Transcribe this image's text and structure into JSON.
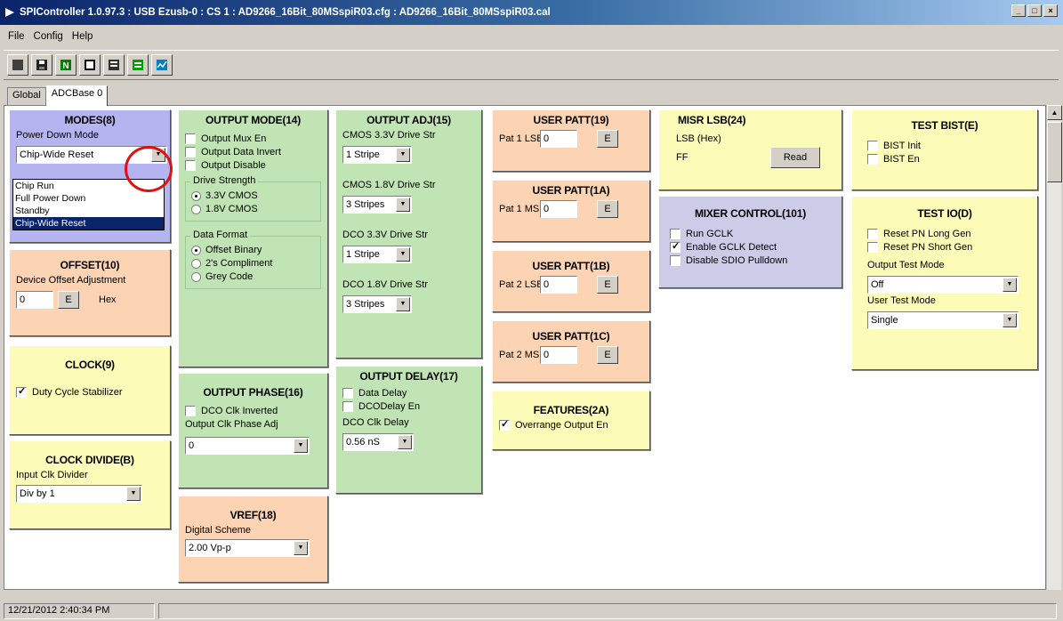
{
  "window": {
    "title": "SPIController 1.0.97.3 : USB Ezusb-0 : CS 1 : AD9266_16Bit_80MSspiR03.cfg : AD9266_16Bit_80MSspiR03.cal",
    "min": "_",
    "max": "□",
    "close": "×"
  },
  "menu": [
    "File",
    "Config",
    "Help"
  ],
  "toolbar": {
    "icons": [
      "stop-icon",
      "save-icon",
      "new-icon",
      "window-icon",
      "register-icon",
      "export-icon",
      "graph-icon"
    ],
    "colors": [
      "#404040",
      "#202020",
      "#008000",
      "#000000",
      "#303030",
      "#00a000",
      "#0080c0"
    ]
  },
  "tabs": [
    {
      "label": "Global"
    },
    {
      "label": "ADCBase 0"
    }
  ],
  "colors": {
    "modes": "#b4b4f0",
    "green": "#c0e4b4",
    "orange": "#fcd4b4",
    "yellow": "#fcfcb8",
    "lavender": "#cccce8",
    "highlight": "#e01010"
  },
  "modes": {
    "title": "MODES(8)",
    "label": "Power Down Mode",
    "value": "Chip-Wide Reset",
    "options": [
      "Chip Run",
      "Full Power Down",
      "Standby",
      "Chip-Wide Reset"
    ]
  },
  "offset": {
    "title": "OFFSET(10)",
    "label": "Device Offset Adjustment",
    "value": "0",
    "e": "E",
    "unit": "Hex"
  },
  "clock": {
    "title": "CLOCK(9)",
    "cb": "Duty Cycle Stabilizer",
    "checked": true
  },
  "clock_divide": {
    "title": "CLOCK DIVIDE(B)",
    "label": "Input Clk Divider",
    "value": "Div by 1"
  },
  "output_mode": {
    "title": "OUTPUT MODE(14)",
    "checkboxes": [
      "Output Mux En",
      "Output Data Invert",
      "Output Disable"
    ],
    "drive_strength": {
      "label": "Drive Strength",
      "options": [
        "3.3V CMOS",
        "1.8V CMOS"
      ],
      "selected": 0
    },
    "data_format": {
      "label": "Data Format",
      "options": [
        "Offset Binary",
        "2's Compliment",
        "Grey Code"
      ],
      "selected": 0
    }
  },
  "output_phase": {
    "title": "OUTPUT PHASE(16)",
    "cb": "DCO Clk Inverted",
    "label": "Output Clk Phase Adj",
    "value": "0"
  },
  "vref": {
    "title": "VREF(18)",
    "label": "Digital Scheme",
    "value": "2.00 Vp-p"
  },
  "output_adj": {
    "title": "OUTPUT ADJ(15)",
    "items": [
      {
        "label": "CMOS 3.3V Drive Str",
        "value": "1 Stripe"
      },
      {
        "label": "CMOS 1.8V Drive Str",
        "value": "3 Stripes"
      },
      {
        "label": "DCO 3.3V Drive Str",
        "value": "1 Stripe"
      },
      {
        "label": "DCO 1.8V Drive Str",
        "value": "3 Stripes"
      }
    ]
  },
  "output_delay": {
    "title": "OUTPUT DELAY(17)",
    "checkboxes": [
      "Data Delay",
      "DCODelay En"
    ],
    "label": "DCO Clk Delay",
    "value": "0.56 nS"
  },
  "user_patt": [
    {
      "title": "USER PATT(19)",
      "label": "Pat 1 LSB",
      "value": "0",
      "e": "E"
    },
    {
      "title": "USER PATT(1A)",
      "label": "Pat 1 MSB",
      "value": "0",
      "e": "E"
    },
    {
      "title": "USER PATT(1B)",
      "label": "Pat 2 LSB",
      "value": "0",
      "e": "E"
    },
    {
      "title": "USER PATT(1C)",
      "label": "Pat 2 MSB",
      "value": "0",
      "e": "E"
    }
  ],
  "features": {
    "title": "FEATURES(2A)",
    "cb": "Overrange Output En",
    "checked": true
  },
  "misr": {
    "title": "MISR LSB(24)",
    "label": "LSB  (Hex)",
    "value": "FF",
    "read": "Read"
  },
  "mixer": {
    "title": "MIXER CONTROL(101)",
    "checkboxes": [
      "Run GCLK",
      "Enable GCLK Detect",
      "Disable SDIO Pulldown"
    ],
    "checked": [
      false,
      true,
      false
    ]
  },
  "test_bist": {
    "title": "TEST BIST(E)",
    "checkboxes": [
      "BIST Init",
      "BIST En"
    ]
  },
  "test_io": {
    "title": "TEST IO(D)",
    "checkboxes": [
      "Reset PN Long Gen",
      "Reset PN Short Gen"
    ],
    "label1": "Output Test Mode",
    "value1": "Off",
    "label2": "User Test Mode",
    "value2": "Single"
  },
  "status": {
    "timestamp": "12/21/2012 2:40:34 PM"
  }
}
